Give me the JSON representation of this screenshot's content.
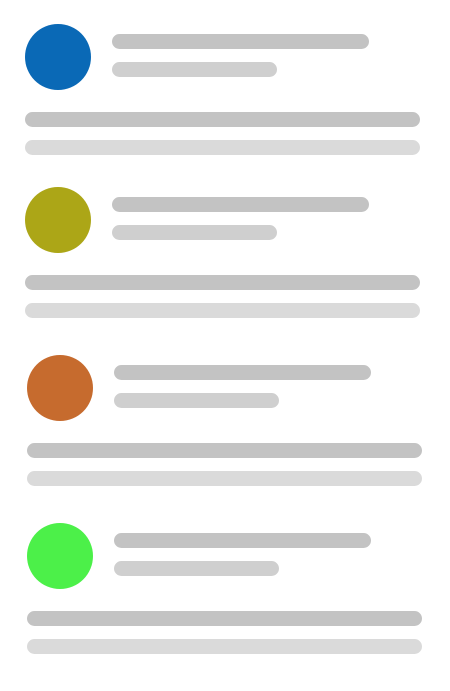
{
  "cards": [
    {
      "avatar_color": "#0a69b6"
    },
    {
      "avatar_color": "#aca617"
    },
    {
      "avatar_color": "#c66b2e"
    },
    {
      "avatar_color": "#4cf049"
    }
  ],
  "colors": {
    "background": "#ffffff",
    "title_bar": "#c3c3c3",
    "subtitle_bar": "#cfcfcf",
    "body_bar_1": "#c3c3c3",
    "body_bar_2": "#dadada"
  }
}
